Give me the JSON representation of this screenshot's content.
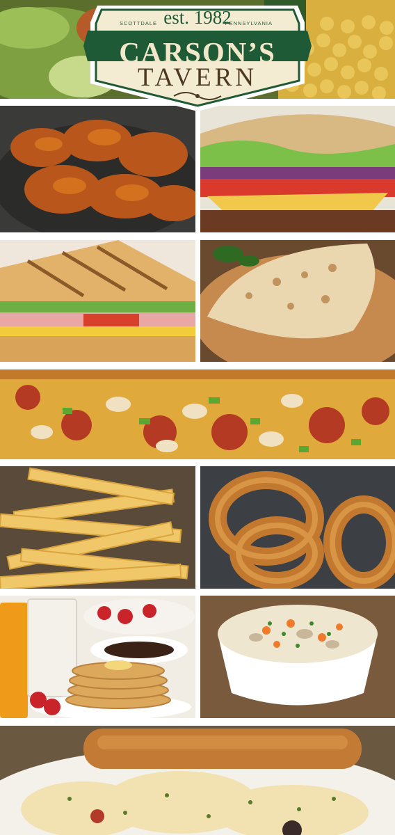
{
  "logo": {
    "est": "est. 1982",
    "city": "SCOTTDALE",
    "state": "PENNSYLVANIA",
    "name": "CARSON’S",
    "subtitle": "TAVERN"
  },
  "colors": {
    "logo_green": "#1f5a37",
    "logo_cream": "#f2e8c9",
    "logo_brown": "#4c3a20",
    "gutter": "#ffffff"
  },
  "photos": [
    {
      "name": "salad-photo"
    },
    {
      "name": "chickpeas-photo"
    },
    {
      "name": "chicken-wings-photo"
    },
    {
      "name": "burger-photo"
    },
    {
      "name": "grilled-sandwich-photo"
    },
    {
      "name": "calzone-photo"
    },
    {
      "name": "pizza-photo"
    },
    {
      "name": "french-fries-photo"
    },
    {
      "name": "onion-rings-photo"
    },
    {
      "name": "breakfast-pancakes-photo"
    },
    {
      "name": "chicken-soup-photo"
    },
    {
      "name": "pasta-breadstick-photo"
    }
  ]
}
